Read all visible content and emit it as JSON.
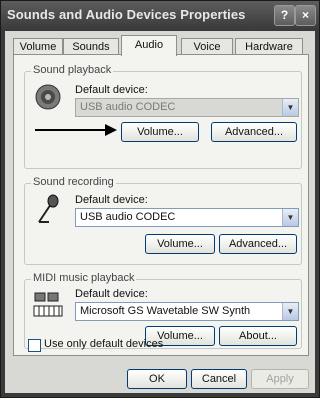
{
  "window": {
    "title": "Sounds and Audio Devices Properties",
    "help_glyph": "?",
    "close_glyph": "×"
  },
  "tabs": [
    {
      "label": "Volume"
    },
    {
      "label": "Sounds"
    },
    {
      "label": "Audio"
    },
    {
      "label": "Voice"
    },
    {
      "label": "Hardware"
    }
  ],
  "active_tab": "Audio",
  "playback": {
    "group_label": "Sound playback",
    "default_label": "Default device:",
    "device": "USB audio CODEC",
    "volume_button": "Volume...",
    "advanced_button": "Advanced..."
  },
  "recording": {
    "group_label": "Sound recording",
    "default_label": "Default device:",
    "device": "USB audio CODEC",
    "volume_button": "Volume...",
    "advanced_button": "Advanced..."
  },
  "midi": {
    "group_label": "MIDI music playback",
    "default_label": "Default device:",
    "device": "Microsoft GS Wavetable SW Synth",
    "volume_button": "Volume...",
    "about_button": "About..."
  },
  "use_default_only": {
    "label": "Use only default devices",
    "checked": false
  },
  "footer": {
    "ok": "OK",
    "cancel": "Cancel",
    "apply": "Apply"
  },
  "icons": {
    "speaker": "speaker-icon",
    "microphone": "microphone-icon",
    "midi": "midi-keyboard-icon",
    "arrow": "pointer-arrow-icon"
  }
}
